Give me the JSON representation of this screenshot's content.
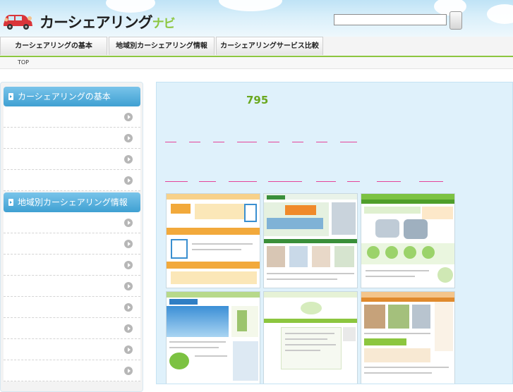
{
  "header": {
    "site_name": "カーシェアリング",
    "site_name_suffix": "ナビ",
    "search": {
      "value": "",
      "placeholder": ""
    }
  },
  "nav": {
    "tabs": [
      {
        "label": "カーシェアリングの基本"
      },
      {
        "label": "地域別カーシェアリング情報"
      },
      {
        "label": "カーシェアリングサービス比較"
      }
    ]
  },
  "breadcrumb": {
    "label": "TOP"
  },
  "sidebar": {
    "sections": [
      {
        "title": "カーシェアリングの基本",
        "item_count": 4
      },
      {
        "title": "地域別カーシェアリング情報",
        "item_count": 8
      }
    ]
  },
  "main": {
    "count": "795",
    "thumbnails": [
      {
        "name": "times-plus-site",
        "accent": "#f2a93b"
      },
      {
        "name": "careco-site",
        "accent": "#3a8f3a"
      },
      {
        "name": "orix-site",
        "accent": "#7cc242"
      },
      {
        "name": "windcar-site",
        "accent": "#2f7ec4"
      },
      {
        "name": "ecoloca-site",
        "accent": "#8cc63f"
      },
      {
        "name": "green-site",
        "accent": "#e08a2d"
      }
    ]
  },
  "colors": {
    "accent_green": "#8cc63f",
    "sidebar_blue": "#3fa0d2",
    "main_bg": "#dff1fb",
    "link_pink": "#e5449a"
  }
}
